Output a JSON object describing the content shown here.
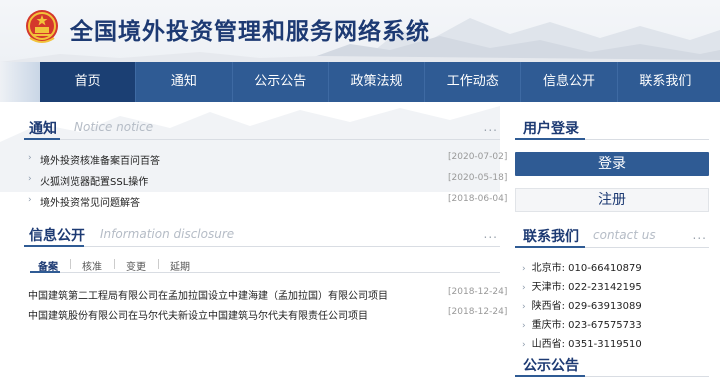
{
  "header": {
    "title": "全国境外投资管理和服务网络系统",
    "emblem_icon": "national-emblem-icon"
  },
  "nav": {
    "items": [
      {
        "label": "首页",
        "active": true
      },
      {
        "label": "通知",
        "active": false
      },
      {
        "label": "公示公告",
        "active": false
      },
      {
        "label": "政策法规",
        "active": false
      },
      {
        "label": "工作动态",
        "active": false
      },
      {
        "label": "信息公开",
        "active": false
      },
      {
        "label": "联系我们",
        "active": false
      }
    ]
  },
  "notice": {
    "title_cn": "通知",
    "title_en": "Notice notice",
    "more": "...",
    "items": [
      {
        "text": "境外投资核准备案百问百答",
        "date": "[2020-07-02]"
      },
      {
        "text": "火狐浏览器配置SSL操作",
        "date": "[2020-05-18]"
      },
      {
        "text": "境外投资常见问题解答",
        "date": "[2018-06-04]"
      }
    ]
  },
  "disclosure": {
    "title_cn": "信息公开",
    "title_en": "Information disclosure",
    "more": "...",
    "tabs": [
      {
        "label": "备案",
        "active": true
      },
      {
        "label": "核准",
        "active": false
      },
      {
        "label": "变更",
        "active": false
      },
      {
        "label": "延期",
        "active": false
      }
    ],
    "items": [
      {
        "text": "中国建筑第二工程局有限公司在孟加拉国设立中建海建（孟加拉国）有限公司项目",
        "date": "[2018-12-24]"
      },
      {
        "text": "中国建筑股份有限公司在马尔代夫新设立中国建筑马尔代夫有限责任公司项目",
        "date": "[2018-12-24]"
      }
    ]
  },
  "user_login": {
    "title_cn": "用户登录",
    "login_label": "登录",
    "register_label": "注册"
  },
  "contact": {
    "title_cn": "联系我们",
    "title_en": "contact us",
    "more": "...",
    "items": [
      "北京市: 010-66410879",
      "天津市: 022-23142195",
      "陕西省: 029-63913089",
      "重庆市: 023-67575733",
      "山西省: 0351-3119510"
    ]
  },
  "announce": {
    "title_cn": "公示公告"
  },
  "colors": {
    "nav_bg": "#2f5b94",
    "nav_active": "#1b3f73",
    "title": "#1d3a73"
  }
}
